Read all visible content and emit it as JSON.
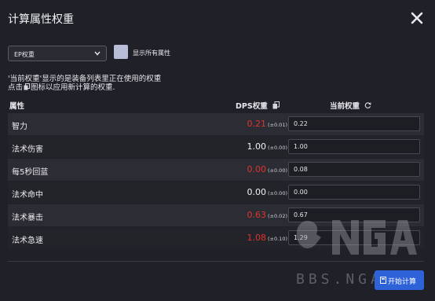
{
  "dialog": {
    "title": "计算属性权重",
    "close_icon": "close-icon"
  },
  "controls": {
    "dropdown_value": "EP权重",
    "checkbox_label": "显示所有属性",
    "checkbox_checked": false
  },
  "info": {
    "line1": "'当前权重'显示的是装备列表里正在使用的权重",
    "line2_prefix": "点击",
    "line2_suffix": "图标以应用新计算的权重."
  },
  "table": {
    "headers": {
      "attr": "属性",
      "dps": "DPS权重",
      "current": "当前权重"
    },
    "rows": [
      {
        "name": "智力",
        "dps": "0.21",
        "dps_err": "(±0.01)",
        "dps_color": "#e0332f",
        "current": "0.22"
      },
      {
        "name": "法术伤害",
        "dps": "1.00",
        "dps_err": "(±0.00)",
        "dps_color": "#f2f2f4",
        "current": "1.00"
      },
      {
        "name": "每5秒回蓝",
        "dps": "0.00",
        "dps_err": "(±0.00)",
        "dps_color": "#e0332f",
        "current": "0.08"
      },
      {
        "name": "法术命中",
        "dps": "0.00",
        "dps_err": "(±0.00)",
        "dps_color": "#f2f2f4",
        "current": "0.00"
      },
      {
        "name": "法术暴击",
        "dps": "0.63",
        "dps_err": "(±0.02)",
        "dps_color": "#e0332f",
        "current": "0.67"
      },
      {
        "name": "法术急速",
        "dps": "1.08",
        "dps_err": "(±0.10)",
        "dps_color": "#e0332f",
        "current": "1.29"
      }
    ]
  },
  "footer": {
    "start_label": "开始计算"
  },
  "watermark": {
    "text": "BBS.NGA.CN"
  }
}
